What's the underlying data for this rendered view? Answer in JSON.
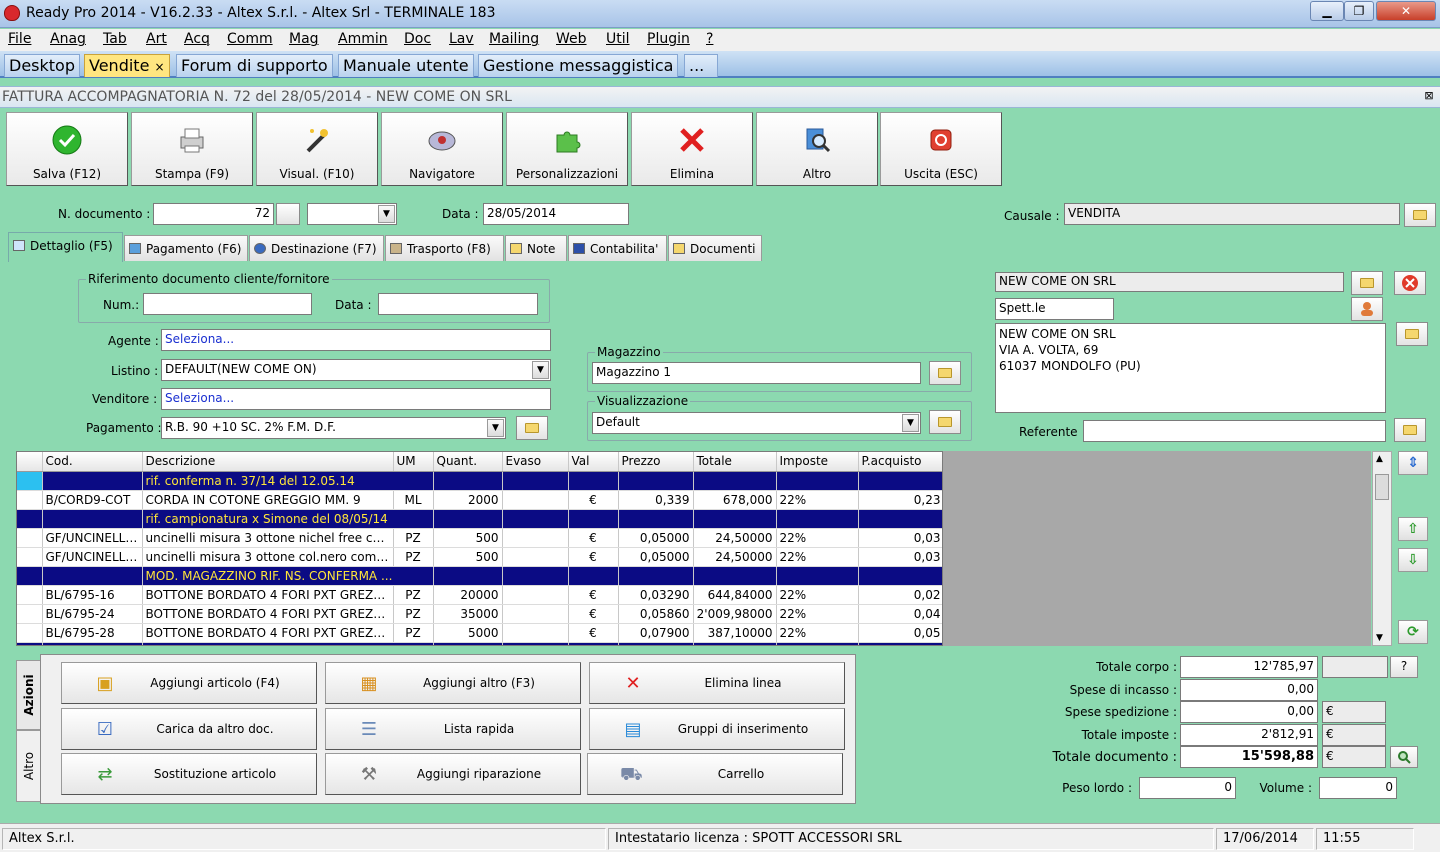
{
  "window": {
    "title": "Ready Pro 2014 - V16.2.33 - Altex S.r.l. - Altex Srl - TERMINALE 183",
    "min": "▁",
    "max": "❐",
    "close": "✕"
  },
  "menu": [
    "File",
    "Anag",
    "Tab",
    "Art",
    "Acq",
    "Comm",
    "Mag",
    "Ammin",
    "Doc",
    "Lav",
    "Mailing",
    "Web",
    "Util",
    "Plugin",
    "?"
  ],
  "tabs": {
    "t0": "Desktop",
    "t1": "Vendite",
    "close": "×",
    "t2": "Forum di supporto",
    "t3": "Manuale utente",
    "t4": "Gestione messaggistica",
    "t5": "..."
  },
  "doc": {
    "title": "FATTURA ACCOMPAGNATORIA N. 72 del 28/05/2014 - NEW COME ON SRL",
    "close": "⊠"
  },
  "toolbar": {
    "save": "Salva (F12)",
    "print": "Stampa (F9)",
    "view": "Visual. (F10)",
    "nav": "Navigatore",
    "custom": "Personalizzazioni",
    "delete": "Elimina",
    "other": "Altro",
    "exit": "Uscita (ESC)"
  },
  "header": {
    "ndoc_label": "N. documento :",
    "ndoc": "72",
    "data_label": "Data :",
    "data": "28/05/2014",
    "causale_label": "Causale :",
    "causale": "VENDITA"
  },
  "dtabs": {
    "d1": "Dettaglio (F5)",
    "d2": "Pagamento (F6)",
    "d3": "Destinazione (F7)",
    "d4": "Trasporto (F8)",
    "d5": "Note",
    "d6": "Contabilita'",
    "d7": "Documenti"
  },
  "ref": {
    "legend": "Riferimento documento cliente/fornitore",
    "num_label": "Num.:",
    "data_label": "Data :"
  },
  "form": {
    "agente_label": "Agente :",
    "agente": "Seleziona...",
    "listino_label": "Listino :",
    "listino": "DEFAULT(NEW COME ON)",
    "venditore_label": "Venditore :",
    "venditore": "Seleziona...",
    "pagamento_label": "Pagamento :",
    "pagamento": "R.B. 90 +10 SC. 2% F.M. D.F."
  },
  "magazzino": {
    "legend": "Magazzino",
    "value": "Magazzino 1"
  },
  "visual": {
    "legend": "Visualizzazione",
    "value": "Default"
  },
  "customer": {
    "name": "NEW COME ON SRL",
    "title": "Spett.le",
    "addr1": "NEW COME ON SRL",
    "addr2": "VIA A. VOLTA, 69",
    "addr3": "61037 MONDOLFO (PU)",
    "referente_label": "Referente"
  },
  "grid": {
    "headers": {
      "cod": "Cod.",
      "desc": "Descrizione",
      "um": "UM",
      "quant": "Quant.",
      "evaso": "Evaso",
      "val": "Val",
      "prezzo": "Prezzo",
      "totale": "Totale",
      "imposte": "Imposte",
      "pacq": "P.acquisto"
    },
    "rows": [
      {
        "desc": "rif. conferma n. 37/14 del 12.05.14"
      },
      {
        "cod": "B/CORD9-COT",
        "desc": "CORDA IN COTONE GREGGIO MM. 9",
        "um": "ML",
        "quant": "2000",
        "val": "€",
        "prezzo": "0,339",
        "totale": "678,000",
        "imposte": "22%",
        "pacq": "0,23"
      },
      {
        "desc": "rif. campionatura x Simone del 08/05/14"
      },
      {
        "cod": "GF/UNCINELLI...",
        "desc": "uncinelli misura 3 ottone nichel free com...",
        "um": "PZ",
        "quant": "500",
        "val": "€",
        "prezzo": "0,05000",
        "totale": "24,50000",
        "imposte": "22%",
        "pacq": "0,03"
      },
      {
        "cod": "GF/UNCINELLI...",
        "desc": "uncinelli misura 3 ottone col.nero compl...",
        "um": "PZ",
        "quant": "500",
        "val": "€",
        "prezzo": "0,05000",
        "totale": "24,50000",
        "imposte": "22%",
        "pacq": "0,03"
      },
      {
        "desc": "MOD. MAGAZZINO RIF. NS. CONFERMA ..."
      },
      {
        "cod": "BL/6795-16",
        "desc": "BOTTONE BORDATO 4 FORI PXT GREZZ...",
        "um": "PZ",
        "quant": "20000",
        "val": "€",
        "prezzo": "0,03290",
        "totale": "644,84000",
        "imposte": "22%",
        "pacq": "0,02"
      },
      {
        "cod": "BL/6795-24",
        "desc": "BOTTONE BORDATO 4 FORI PXT GREZZ...",
        "um": "PZ",
        "quant": "35000",
        "val": "€",
        "prezzo": "0,05860",
        "totale": "2'009,98000",
        "imposte": "22%",
        "pacq": "0,04"
      },
      {
        "cod": "BL/6795-28",
        "desc": "BOTTONE BORDATO 4 FORI PXT GREZZ...",
        "um": "PZ",
        "quant": "5000",
        "val": "€",
        "prezzo": "0,07900",
        "totale": "387,10000",
        "imposte": "22%",
        "pacq": "0,05"
      }
    ]
  },
  "actions": {
    "tab_azioni": "Azioni",
    "tab_altro": "Altro",
    "a1": "Aggiungi articolo (F4)",
    "a2": "Aggiungi altro (F3)",
    "a3": "Elimina linea",
    "a4": "Carica da altro doc.",
    "a5": "Lista rapida",
    "a6": "Gruppi di inserimento",
    "a7": "Sostituzione articolo",
    "a8": "Aggiungi riparazione",
    "a9": "Carrello"
  },
  "totals": {
    "corpo_label": "Totale corpo :",
    "corpo": "12'785,97",
    "help": "?",
    "incasso_label": "Spese di incasso :",
    "incasso": "0,00",
    "sped_label": "Spese spedizione :",
    "sped": "0,00",
    "imposte_label": "Totale imposte :",
    "imposte": "2'812,91",
    "doc_label": "Totale documento :",
    "doc": "15'598,88",
    "euro": "€",
    "peso_label": "Peso lordo :",
    "peso": "0",
    "volume_label": "Volume :",
    "volume": "0"
  },
  "status": {
    "company": "Altex S.r.l.",
    "license": "Intestatario licenza : SPOTT ACCESSORI SRL",
    "date": "17/06/2014",
    "time": "11:55"
  },
  "colors": {
    "bg": "#8cd9b0",
    "note_bg": "#0b0b84",
    "note_fg": "#ffe63a"
  }
}
